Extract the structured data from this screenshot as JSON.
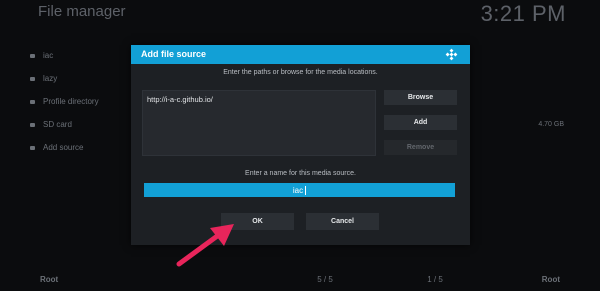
{
  "background": {
    "title": "File manager",
    "clock": "3:21 PM",
    "items": [
      {
        "label": "iac",
        "size": ""
      },
      {
        "label": "lazy",
        "size": ""
      },
      {
        "label": "Profile directory",
        "size": ""
      },
      {
        "label": "SD card",
        "size": "4.70 GB"
      },
      {
        "label": "Add source",
        "size": ""
      }
    ],
    "footer": {
      "left": "Root",
      "page_left": "5 / 5",
      "page_right": "1 / 5",
      "right": "Root"
    }
  },
  "dialog": {
    "title": "Add file source",
    "icon": "kodi-logo-icon",
    "paths_hint": "Enter the paths or browse for the media locations.",
    "paths": [
      "http://i-a-c.github.io/"
    ],
    "browse_label": "Browse",
    "add_label": "Add",
    "remove_label": "Remove",
    "name_hint": "Enter a name for this media source.",
    "name_value": "iac",
    "ok_label": "OK",
    "cancel_label": "Cancel"
  },
  "colors": {
    "accent": "#12a0d6",
    "arrow": "#e8255b",
    "dialog_bg": "#1d2024",
    "button_bg": "#2b2f34"
  }
}
